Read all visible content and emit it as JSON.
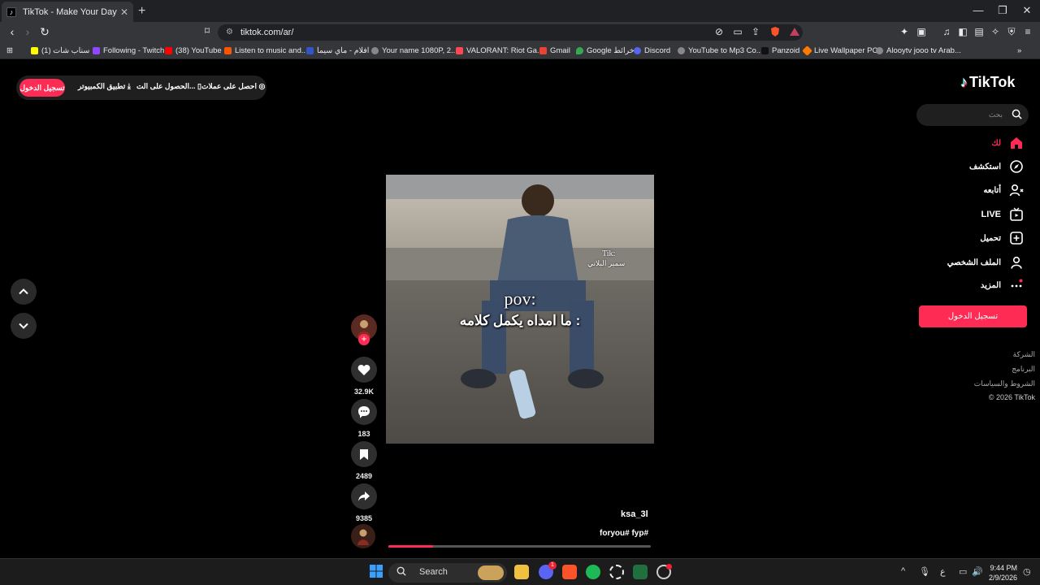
{
  "browser": {
    "tab_title": "TikTok - Make Your Day",
    "tab_close": "✕",
    "new_tab": "+",
    "url": "tiktok.com/ar/",
    "bookmarks": [
      "(1) سناب شات",
      "Following - Twitch",
      "(38) YouTube",
      "Listen to music and...",
      "افلام - ماي سيما",
      "Your name 1080P, 2...",
      "VALORANT: Riot Ga...",
      "Gmail",
      "Google خرائط",
      "Discord",
      "YouTube to Mp3 Co...",
      "Panzoid",
      "Live Wallpaper PC",
      "Alooytv jooo tv Arab..."
    ],
    "shield_badge": "2",
    "alert_badge": "1"
  },
  "top_bar": {
    "login": "تسجيل الدخول",
    "desktop_app": "تطبيق الكمبيوتر",
    "get_app": "الحصول على الت...",
    "get_coins": "احصل على عملات"
  },
  "sidebar": {
    "logo": "TikTok",
    "search_placeholder": "بحث",
    "nav": [
      {
        "label": "لك",
        "active": true
      },
      {
        "label": "استكشف"
      },
      {
        "label": "أتابعه"
      },
      {
        "label": "LIVE"
      },
      {
        "label": "تحميل"
      },
      {
        "label": "الملف الشخصي"
      },
      {
        "label": "المزيد"
      }
    ],
    "login_button": "تسجيل الدخول",
    "footer": [
      "الشركة",
      "البرنامج",
      "الشروط والسياسات",
      "© 2026 TikTok"
    ]
  },
  "video": {
    "overlay_title": "pov:",
    "overlay_text": "ما امداه يكمل كلامه :",
    "watermark_top": "Tik:",
    "watermark_name": "سمير البلاتي",
    "username": "ksa_3l",
    "hashtags": "foryou# fyp#",
    "progress": 0.17
  },
  "actions": {
    "likes": "32.9K",
    "comments": "183",
    "saves": "2489",
    "shares": "9385"
  },
  "taskbar": {
    "search": "Search",
    "lang": "ع",
    "time": "9:44 PM",
    "date": "2/9/2026",
    "discord_badge": "1"
  },
  "colors": {
    "accent": "#fe2c55",
    "background": "#000000",
    "panel": "#1f1f1f"
  }
}
